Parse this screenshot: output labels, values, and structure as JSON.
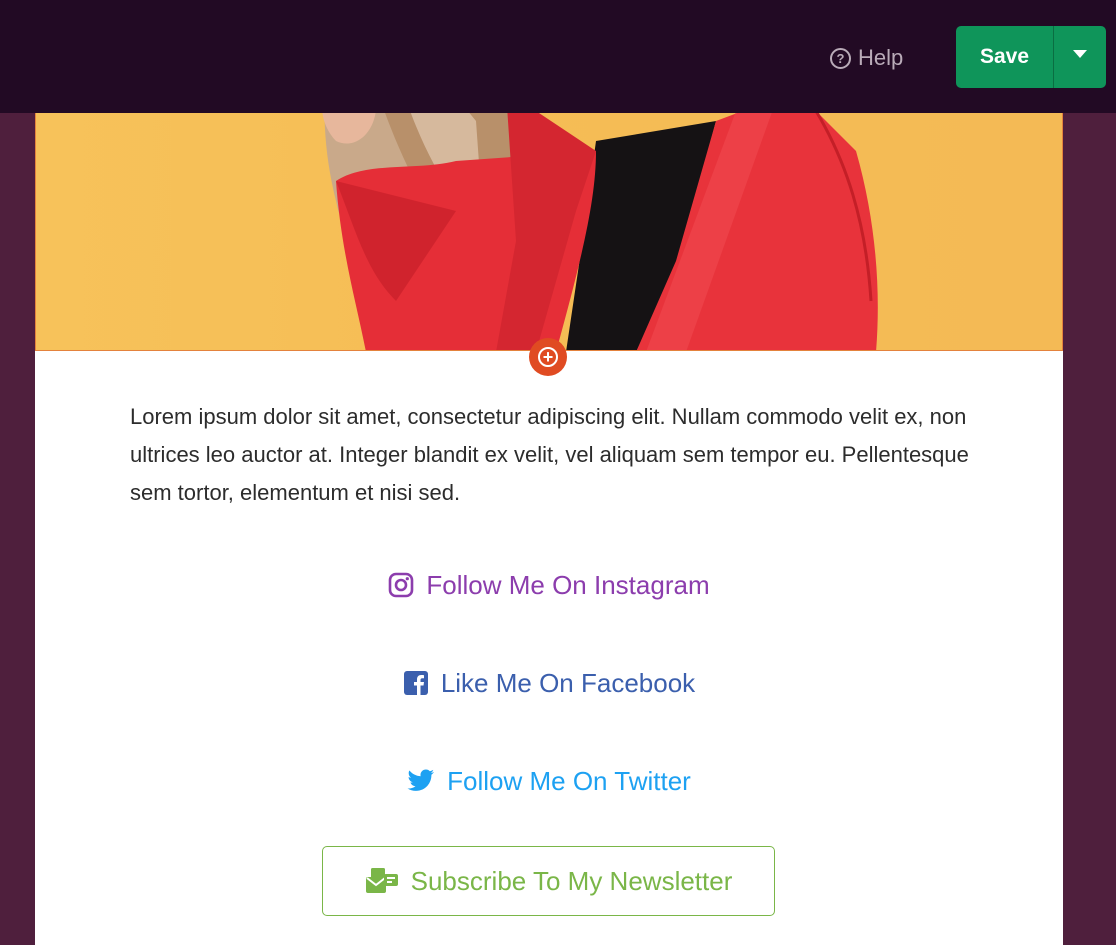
{
  "header": {
    "help_label": "Help",
    "save_label": "Save",
    "colors": {
      "bar": "#220a24",
      "save": "#0f955a"
    }
  },
  "content": {
    "paragraph": "Lorem ipsum dolor sit amet, consectetur adipiscing elit. Nullam commodo velit ex, non ultrices leo auctor at. Integer blandit ex velit, vel aliquam sem tempor eu. Pellentesque sem tortor, elementum et nisi sed.",
    "links": {
      "instagram": {
        "label": "Follow Me On Instagram",
        "icon": "instagram-icon",
        "color": "#8c3dad"
      },
      "facebook": {
        "label": "Like Me On Facebook",
        "icon": "facebook-icon",
        "color": "#3b5fad"
      },
      "twitter": {
        "label": "Follow Me On Twitter",
        "icon": "twitter-icon",
        "color": "#1da1f2"
      }
    },
    "newsletter": {
      "label": "Subscribe To My Newsletter",
      "icon": "newsletter-icon",
      "color": "#7ab648"
    }
  },
  "icons": {
    "help": "question-circle-icon",
    "add_block": "plus-circle-icon",
    "save_menu": "caret-down-icon"
  }
}
